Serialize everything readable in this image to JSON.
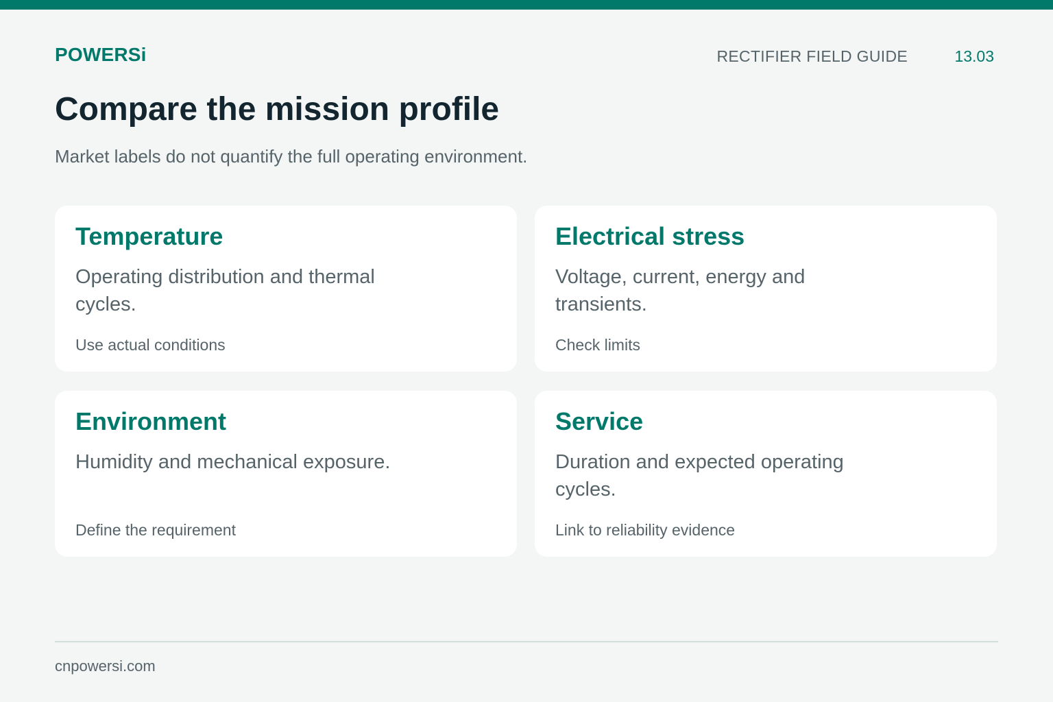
{
  "header": {
    "brand": "POWERSi",
    "guide_title": "RECTIFIER FIELD GUIDE",
    "page_number": "13.03"
  },
  "main": {
    "title": "Compare the mission profile",
    "subtitle": "Market labels do not quantify the full operating environment.",
    "cards": [
      {
        "title": "Temperature",
        "description": "Operating distribution and thermal cycles.",
        "note": "Use actual conditions"
      },
      {
        "title": "Electrical stress",
        "description": "Voltage, current, energy and transients.",
        "note": "Check limits"
      },
      {
        "title": "Environment",
        "description": "Humidity and mechanical exposure.",
        "note": "Define the requirement"
      },
      {
        "title": "Service",
        "description": "Duration and expected operating cycles.",
        "note": "Link to reliability evidence"
      }
    ]
  },
  "footer": {
    "website": "cnpowersi.com"
  },
  "colors": {
    "accent": "#00796b",
    "heading": "#13262f",
    "body_text": "#56646a",
    "background": "#f4f6f5",
    "card_background": "#ffffff",
    "divider": "#cfdfda"
  }
}
